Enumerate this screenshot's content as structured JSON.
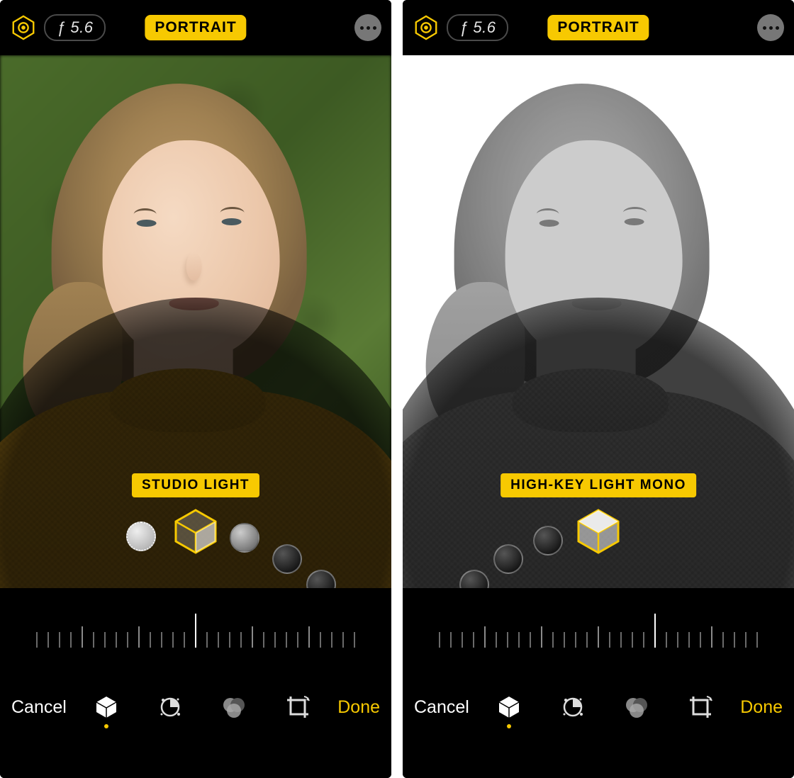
{
  "accent": "#f7c901",
  "left": {
    "aperture": "ƒ 5.6",
    "mode": "PORTRAIT",
    "effect_label": "STUDIO LIGHT",
    "cancel": "Cancel",
    "done": "Done"
  },
  "right": {
    "aperture": "ƒ 5.6",
    "mode": "PORTRAIT",
    "effect_label": "HIGH-KEY LIGHT MONO",
    "cancel": "Cancel",
    "done": "Done"
  }
}
